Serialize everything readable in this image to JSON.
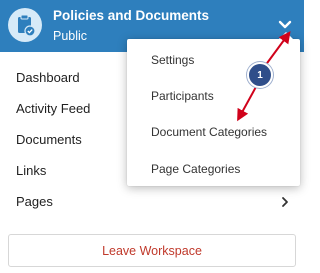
{
  "header": {
    "title": "Policies and Documents",
    "subtitle": "Public",
    "workspace_icon": "clipboard-check-icon",
    "menu_toggle_icon": "chevron-down-icon",
    "background_color": "#2e7fbd"
  },
  "nav": {
    "items": [
      {
        "label": "Dashboard"
      },
      {
        "label": "Activity Feed"
      },
      {
        "label": "Documents"
      },
      {
        "label": "Links"
      },
      {
        "label": "Pages",
        "icon": "chevron-right-icon"
      }
    ]
  },
  "dropdown": {
    "items": [
      {
        "label": "Settings"
      },
      {
        "label": "Participants"
      },
      {
        "label": "Document Categories"
      },
      {
        "label": "Page Categories"
      }
    ]
  },
  "leave_button": {
    "label": "Leave Workspace",
    "color": "#c0392b"
  },
  "annotation": {
    "step_number": "1",
    "badge_color": "#2f4e8a",
    "arrow_color": "#d0021b"
  }
}
